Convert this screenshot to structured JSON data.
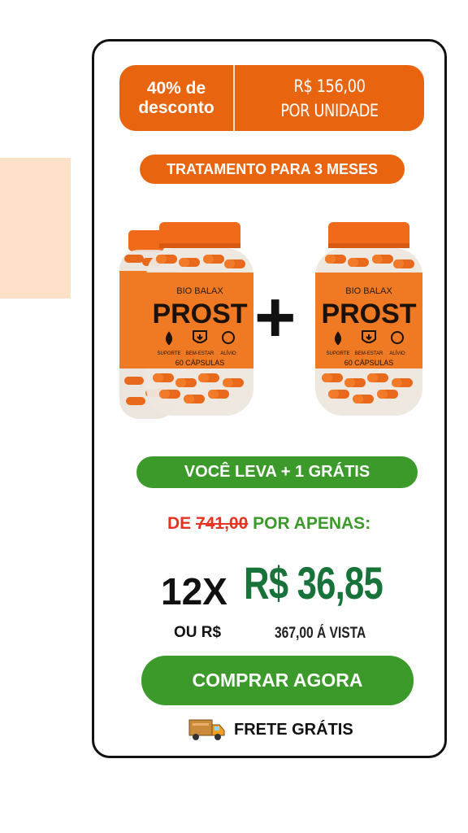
{
  "offer": {
    "discount_line1": "40% de",
    "discount_line2": "desconto",
    "unit_price_line1": "R$ 156,00",
    "unit_price_line2": "POR UNIDADE",
    "treatment": "TRATAMENTO PARA 3 MESES"
  },
  "product": {
    "brand": "BIO BALAX",
    "name": "PROST",
    "icon_labels": [
      "SUPORTE",
      "BEM-ESTAR",
      "ALÍVIO"
    ],
    "capsules": "60 CÁPSULAS",
    "plus": "+"
  },
  "pricing": {
    "bonus": "VOCÊ LEVA + 1 GRÁTIS",
    "from_label": "DE",
    "old_price": "741,00",
    "for_only": "POR APENAS:",
    "installments": "12X",
    "installment_value": "R$ 36,85",
    "or_label": "OU R$",
    "cash_price": "367,00 Á VISTA"
  },
  "cta": {
    "buy_label": "COMPRAR AGORA",
    "shipping": "FRETE GRÁTIS"
  },
  "colors": {
    "accent_orange": "#e8640f",
    "green": "#3b9a2a",
    "dark_green": "#18733a",
    "red": "#e53422"
  }
}
